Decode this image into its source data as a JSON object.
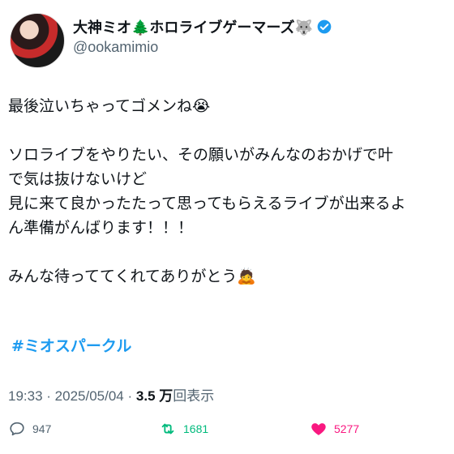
{
  "header": {
    "display_name": "大神ミオ🌲ホロライブゲーマーズ🐺",
    "handle": "@ookamimio"
  },
  "tweet": {
    "lines": [
      "最後泣いちゃってゴメンね😭",
      "",
      "ソロライブをやりたい、その願いがみんなのおかげで叶",
      "で気は抜けないけど",
      "見に来て良かったたって思ってもらえるライブが出来るよ",
      "ん準備がんばります！！！",
      "",
      "みんな待っててくれてありがとう🙇"
    ],
    "hashtag": "#ミオスパークル"
  },
  "meta": {
    "time": "19:33",
    "date": "2025/05/04",
    "views_count": "3.5 万",
    "views_label": "回表示"
  },
  "actions": {
    "replies": "947",
    "retweets": "1681",
    "likes": "5277"
  },
  "colors": {
    "text": "#0f1419",
    "muted": "#536471",
    "link": "#1d9bf0",
    "retweet": "#00ba7c",
    "like": "#f91880",
    "verified": "#1d9bf0"
  }
}
